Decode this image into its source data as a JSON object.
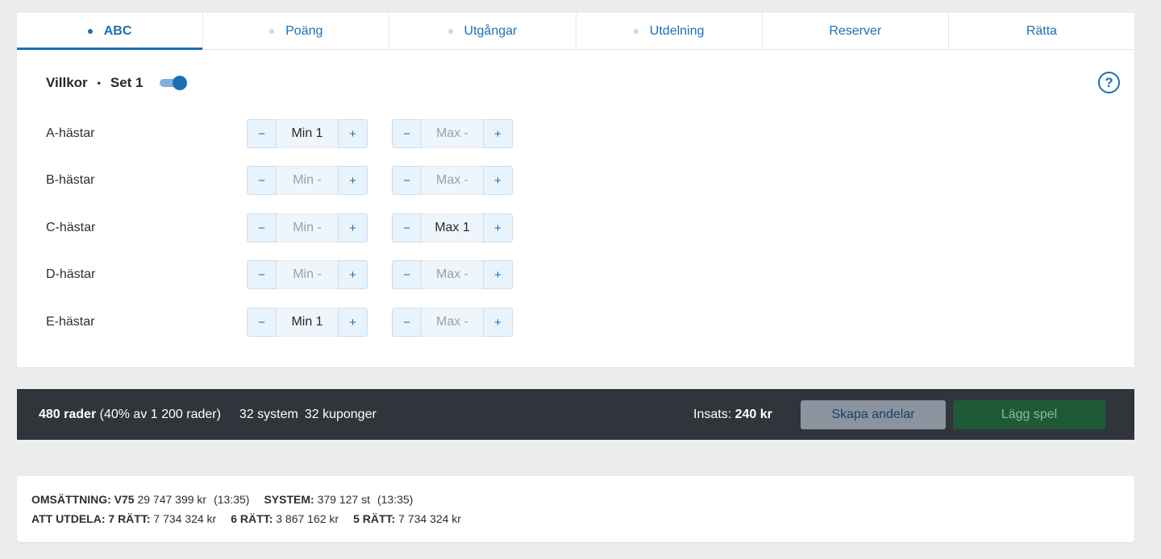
{
  "tabs": [
    {
      "label": "ABC",
      "dot": true,
      "active": true
    },
    {
      "label": "Poäng",
      "dot": true,
      "active": false
    },
    {
      "label": "Utgångar",
      "dot": true,
      "active": false
    },
    {
      "label": "Utdelning",
      "dot": true,
      "active": false
    },
    {
      "label": "Reserver",
      "dot": false,
      "active": false
    },
    {
      "label": "Rätta",
      "dot": false,
      "active": false
    }
  ],
  "panel": {
    "title": "Villkor",
    "separator": "•",
    "set_label": "Set 1",
    "toggle_on": true,
    "help_icon": "?",
    "minus_glyph": "−",
    "plus_glyph": "+",
    "rows": [
      {
        "label": "A-hästar",
        "min": "Min 1",
        "min_set": true,
        "max": "Max -",
        "max_set": false
      },
      {
        "label": "B-hästar",
        "min": "Min -",
        "min_set": false,
        "max": "Max -",
        "max_set": false
      },
      {
        "label": "C-hästar",
        "min": "Min -",
        "min_set": false,
        "max": "Max 1",
        "max_set": true
      },
      {
        "label": "D-hästar",
        "min": "Min -",
        "min_set": false,
        "max": "Max -",
        "max_set": false
      },
      {
        "label": "E-hästar",
        "min": "Min 1",
        "min_set": true,
        "max": "Max -",
        "max_set": false
      }
    ]
  },
  "summary": {
    "rows_count": "480 rader",
    "rows_detail": " (40% av 1 200 rader)",
    "system": "32 system",
    "kuponger": "32 kuponger",
    "insats_label": "Insats: ",
    "insats_value": "240 kr",
    "create_shares": "Skapa andelar",
    "place_bet": "Lägg spel"
  },
  "info": {
    "omsattning_label": "OMSÄTTNING: V75",
    "omsattning_value": " 29 747 399 kr",
    "omsattning_time": "(13:35)",
    "system_label": "SYSTEM:",
    "system_value": " 379 127 st",
    "system_time": "(13:35)",
    "att_utdela_label": "ATT UTDELA: 7 RÄTT:",
    "r7_value": " 7 734 324 kr",
    "r6_label": "6 RÄTT:",
    "r6_value": " 3 867 162 kr",
    "r5_label": "5 RÄTT:",
    "r5_value": " 7 734 324 kr"
  },
  "colors": {
    "accent": "#1b6fb5",
    "summary_bg": "#30353b",
    "create_shares_bg": "#8b949e",
    "place_bet_bg": "#1f5a38"
  }
}
